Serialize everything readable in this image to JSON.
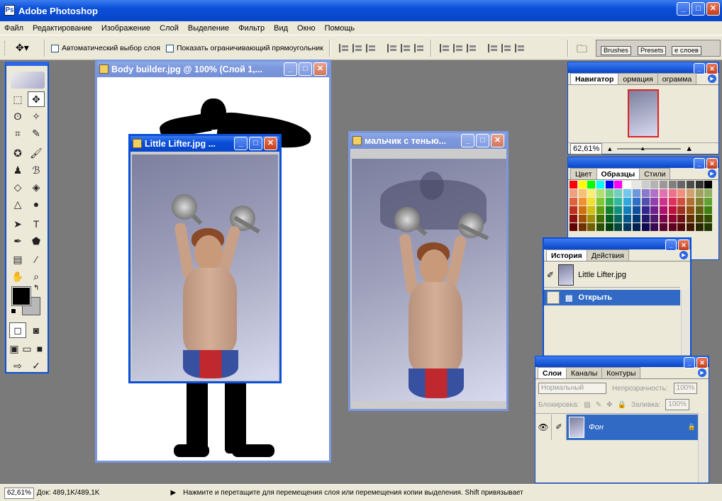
{
  "app": {
    "title": "Adobe Photoshop",
    "icon_text": "Ps"
  },
  "menu": [
    "Файл",
    "Редактирование",
    "Изображение",
    "Слой",
    "Выделение",
    "Фильтр",
    "Вид",
    "Окно",
    "Помощь"
  ],
  "options": {
    "auto_select_label": "Автоматический выбор слоя",
    "show_bounds_label": "Показать ограничивающий прямоугольник",
    "well_tabs": [
      "Brushes",
      "Presets",
      "е слоев"
    ]
  },
  "documents": {
    "bodybuilder_title": "Body builder.jpg @ 100% (Слой 1,...",
    "little_lifter_title": "Little Lifter.jpg ...",
    "boy_shadow_title": "мальчик с тенью..."
  },
  "navigator": {
    "tabs": [
      "Навигатор",
      "ормация",
      "ограмма"
    ],
    "zoom": "62,61%"
  },
  "swatches_panel": {
    "tabs": [
      "Цвет",
      "Образцы",
      "Стили"
    ],
    "colors": [
      "#ff0000",
      "#ffff00",
      "#00ff00",
      "#00ffff",
      "#0000ff",
      "#ff00ff",
      "#ffffff",
      "#e6e6e6",
      "#cccccc",
      "#b3b3b3",
      "#999999",
      "#808080",
      "#666666",
      "#4d4d4d",
      "#333333",
      "#000000",
      "#f0a080",
      "#f8c070",
      "#f8f070",
      "#b0e070",
      "#70d080",
      "#70d0c0",
      "#70c8f0",
      "#7098e0",
      "#8878d0",
      "#b070c8",
      "#e070b0",
      "#f07090",
      "#f09080",
      "#d0a070",
      "#a0a060",
      "#90b060",
      "#e06040",
      "#f09030",
      "#f0e030",
      "#80c830",
      "#30b050",
      "#30b8a0",
      "#30a8e0",
      "#3070c8",
      "#5050b0",
      "#9040b0",
      "#d03090",
      "#e03060",
      "#d05040",
      "#b07030",
      "#808030",
      "#60a030",
      "#c03020",
      "#d07010",
      "#d0c010",
      "#60a010",
      "#108030",
      "#109080",
      "#1080c0",
      "#1050a0",
      "#302890",
      "#702090",
      "#b01070",
      "#c01040",
      "#a03020",
      "#905010",
      "#606010",
      "#408010",
      "#901010",
      "#a05000",
      "#a09000",
      "#407000",
      "#006020",
      "#006860",
      "#005890",
      "#003878",
      "#201870",
      "#501870",
      "#800050",
      "#900030",
      "#701010",
      "#603000",
      "#404000",
      "#305000",
      "#600000",
      "#703000",
      "#706000",
      "#285000",
      "#004010",
      "#004840",
      "#003860",
      "#002050",
      "#100850",
      "#380850",
      "#580030",
      "#600020",
      "#500808",
      "#401800",
      "#282800",
      "#203800"
    ]
  },
  "history": {
    "tabs": [
      "История",
      "Действия"
    ],
    "snapshot_label": "Little Lifter.jpg",
    "step_label": "Открыть"
  },
  "layers": {
    "tabs": [
      "Слои",
      "Каналы",
      "Контуры"
    ],
    "blend_mode": "Нормальный",
    "opacity_label": "Непрозрачность:",
    "opacity_value": "100%",
    "lock_label": "Блокировка:",
    "fill_label": "Заливка:",
    "fill_value": "100%",
    "layer_name": "Фон"
  },
  "status": {
    "zoom": "62,61%",
    "doc_info": "Док: 489,1K/489,1K",
    "hint": "Нажмите и перетащите для перемещения слоя или перемещения копии выделения. Shift привязывает"
  },
  "colors": {
    "titlebar": "#0a4fd8",
    "chrome": "#ece9d8",
    "workspace": "#7a7a7a",
    "selection": "#316ac5"
  }
}
